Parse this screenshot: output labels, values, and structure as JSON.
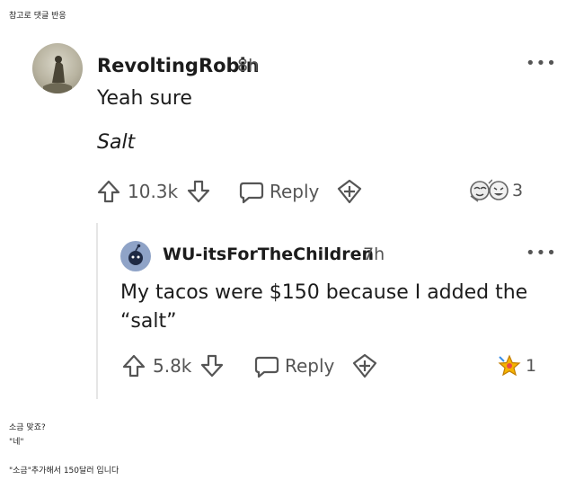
{
  "header_caption": "참고로 댓글 반응",
  "comment": {
    "username": "RevoltingRobin",
    "time": "8h",
    "line1": "Yeah sure",
    "line2": "Salt",
    "upvotes": "10.3k",
    "reply_label": "Reply",
    "award_count": "3"
  },
  "reply": {
    "username": "WU-itsForTheChildren",
    "time": "7h",
    "text": "My tacos were $150 because I added the “salt”",
    "upvotes": "5.8k",
    "reply_label": "Reply",
    "award_count": "1"
  },
  "footer": {
    "line1": "소금 맞죠?",
    "line2": "\"네\"",
    "line3": "\"소금\"추가해서 150달러 입니다"
  },
  "colors": {
    "text": "#1c1c1c",
    "muted": "#555555",
    "avatar2": "#8fa3c7",
    "award_star": "#f5b400"
  },
  "icons": [
    "upvote-icon",
    "downvote-icon",
    "comment-bubble-icon",
    "award-plus-icon",
    "more-options-icon"
  ]
}
